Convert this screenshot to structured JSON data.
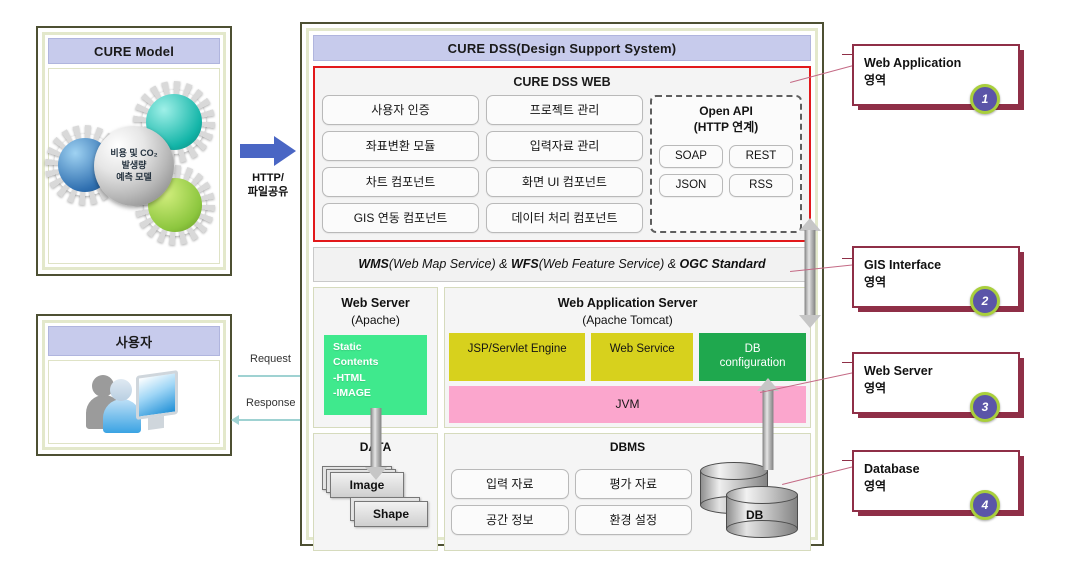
{
  "cure_model": {
    "title": "CURE Model",
    "sphere_label": "비용 및 CO₂\n발생량\n예측 모델",
    "gears": [
      {
        "name": "gear-blue",
        "label": ""
      },
      {
        "name": "gear-teal",
        "label": ""
      },
      {
        "name": "gear-green",
        "label": ""
      }
    ]
  },
  "user": {
    "title": "사용자"
  },
  "transfer_arrow": {
    "caption": "HTTP/\n파일공유"
  },
  "flows": {
    "request": "Request",
    "response": "Response"
  },
  "dss": {
    "title": "CURE DSS(Design Support System)",
    "web": {
      "title": "CURE DSS WEB",
      "column_left": [
        "사용자 인증",
        "좌표변환 모듈",
        "차트 컴포넌트",
        "GIS 연동 컴포넌트"
      ],
      "column_right": [
        "프로젝트 관리",
        "입력자료 관리",
        "화면 UI 컴포넌트",
        "데이터 처리 컴포넌트"
      ],
      "open_api": {
        "title": "Open API\n(HTTP 연계)",
        "items": [
          "SOAP",
          "REST",
          "JSON",
          "RSS"
        ]
      }
    },
    "gis_band": {
      "part1_bold": "WMS",
      "part1_rest": "(Web Map Service) & ",
      "part2_bold": "WFS",
      "part2_rest": "(Web Feature Service) & ",
      "part3_bold": "OGC Standard",
      "full_text": "WMS(Web Map Service) & WFS(Web Feature Service) & OGC Standard"
    },
    "web_server": {
      "title": "Web Server",
      "subtitle": "(Apache)",
      "static_contents": "Static\nContents\n-HTML\n-IMAGE"
    },
    "was": {
      "title": "Web Application Server",
      "subtitle": "(Apache Tomcat)",
      "tiles": [
        {
          "label": "JSP/Servlet Engine",
          "color": "#d7d11d"
        },
        {
          "label": "Web Service",
          "color": "#d7d11d"
        },
        {
          "label": "DB\nconfiguration",
          "color": "#1fa84e"
        }
      ],
      "jvm": "JVM"
    },
    "data": {
      "title": "DATA",
      "items": [
        "Image",
        "Shape"
      ]
    },
    "dbms": {
      "title": "DBMS",
      "items": [
        "입력 자료",
        "평가 자료",
        "공간 정보",
        "환경 설정"
      ],
      "db_label": "DB"
    }
  },
  "callouts": [
    {
      "title": "Web Application",
      "subtitle": "영역",
      "number": "1"
    },
    {
      "title": "GIS Interface",
      "subtitle": "영역",
      "number": "2"
    },
    {
      "title": "Web Server",
      "subtitle": "영역",
      "number": "3"
    },
    {
      "title": "Database",
      "subtitle": "영역",
      "number": "4"
    }
  ],
  "colors": {
    "highlight_red": "#e2191b",
    "callout_border": "#8f2f47",
    "badge_fill": "#5b55a8",
    "badge_ring": "#a9cf3c",
    "frame_outer": "#4d5033",
    "frame_inner": "#e3e8cb",
    "title_bar": "#c7cbec",
    "static_green": "#3fe98d",
    "tile_olive": "#d7d11d",
    "tile_green": "#1fa84e",
    "jvm_pink": "#fba6cd",
    "blue_arrow": "#4a66c4",
    "flow_arrow": "#9fd2d2"
  }
}
